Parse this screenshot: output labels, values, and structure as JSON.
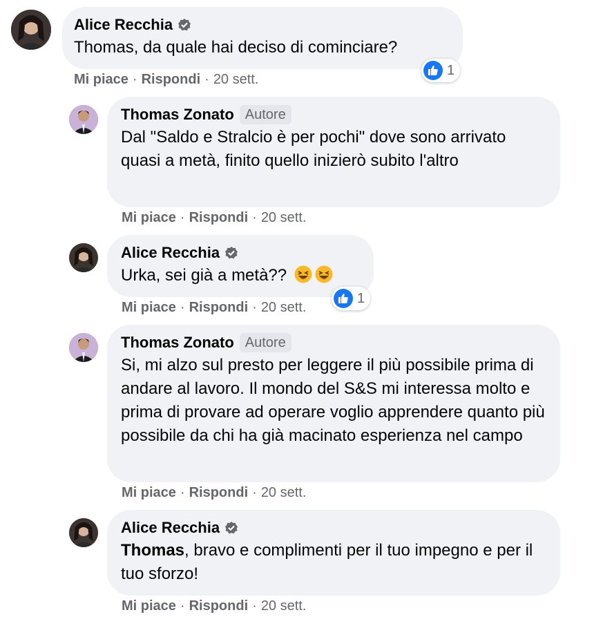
{
  "comments": [
    {
      "author": "Alice Recchia",
      "verified": true,
      "badge": "",
      "text": "Thomas, da quale hai deciso di cominciare?",
      "reactions": "1",
      "like": "Mi piace",
      "reply": "Rispondi",
      "time": "20 sett."
    },
    {
      "author": "Thomas Zonato",
      "verified": false,
      "badge": "Autore",
      "text": "Dal \"Saldo e Stralcio è per pochi\" dove sono arrivato quasi a metà, finito quello inizierò subito l'altro",
      "like": "Mi piace",
      "reply": "Rispondi",
      "time": "20 sett."
    },
    {
      "author": "Alice Recchia",
      "verified": true,
      "badge": "",
      "text": "Urka, sei già a metà??",
      "emoji": "laughing-face",
      "reactions": "1",
      "like": "Mi piace",
      "reply": "Rispondi",
      "time": "20 sett."
    },
    {
      "author": "Thomas Zonato",
      "verified": false,
      "badge": "Autore",
      "text": "Si, mi alzo sul presto per leggere il più possibile prima di andare al lavoro. Il mondo del S&S mi interessa molto e prima di provare ad operare voglio apprendere quanto più possibile da chi ha già macinato esperienza nel campo",
      "like": "Mi piace",
      "reply": "Rispondi",
      "time": "20 sett."
    },
    {
      "author": "Alice Recchia",
      "verified": true,
      "badge": "",
      "mention": "Thomas",
      "text": ", bravo e complimenti per il tuo impegno e per il tuo sforzo!",
      "like": "Mi piace",
      "reply": "Rispondi",
      "time": "20 sett."
    }
  ],
  "colors": {
    "bubble": "#f0f2f5",
    "like_blue": "#1877f2",
    "muted": "#65676b",
    "badge_bg": "#e4e6eb"
  }
}
